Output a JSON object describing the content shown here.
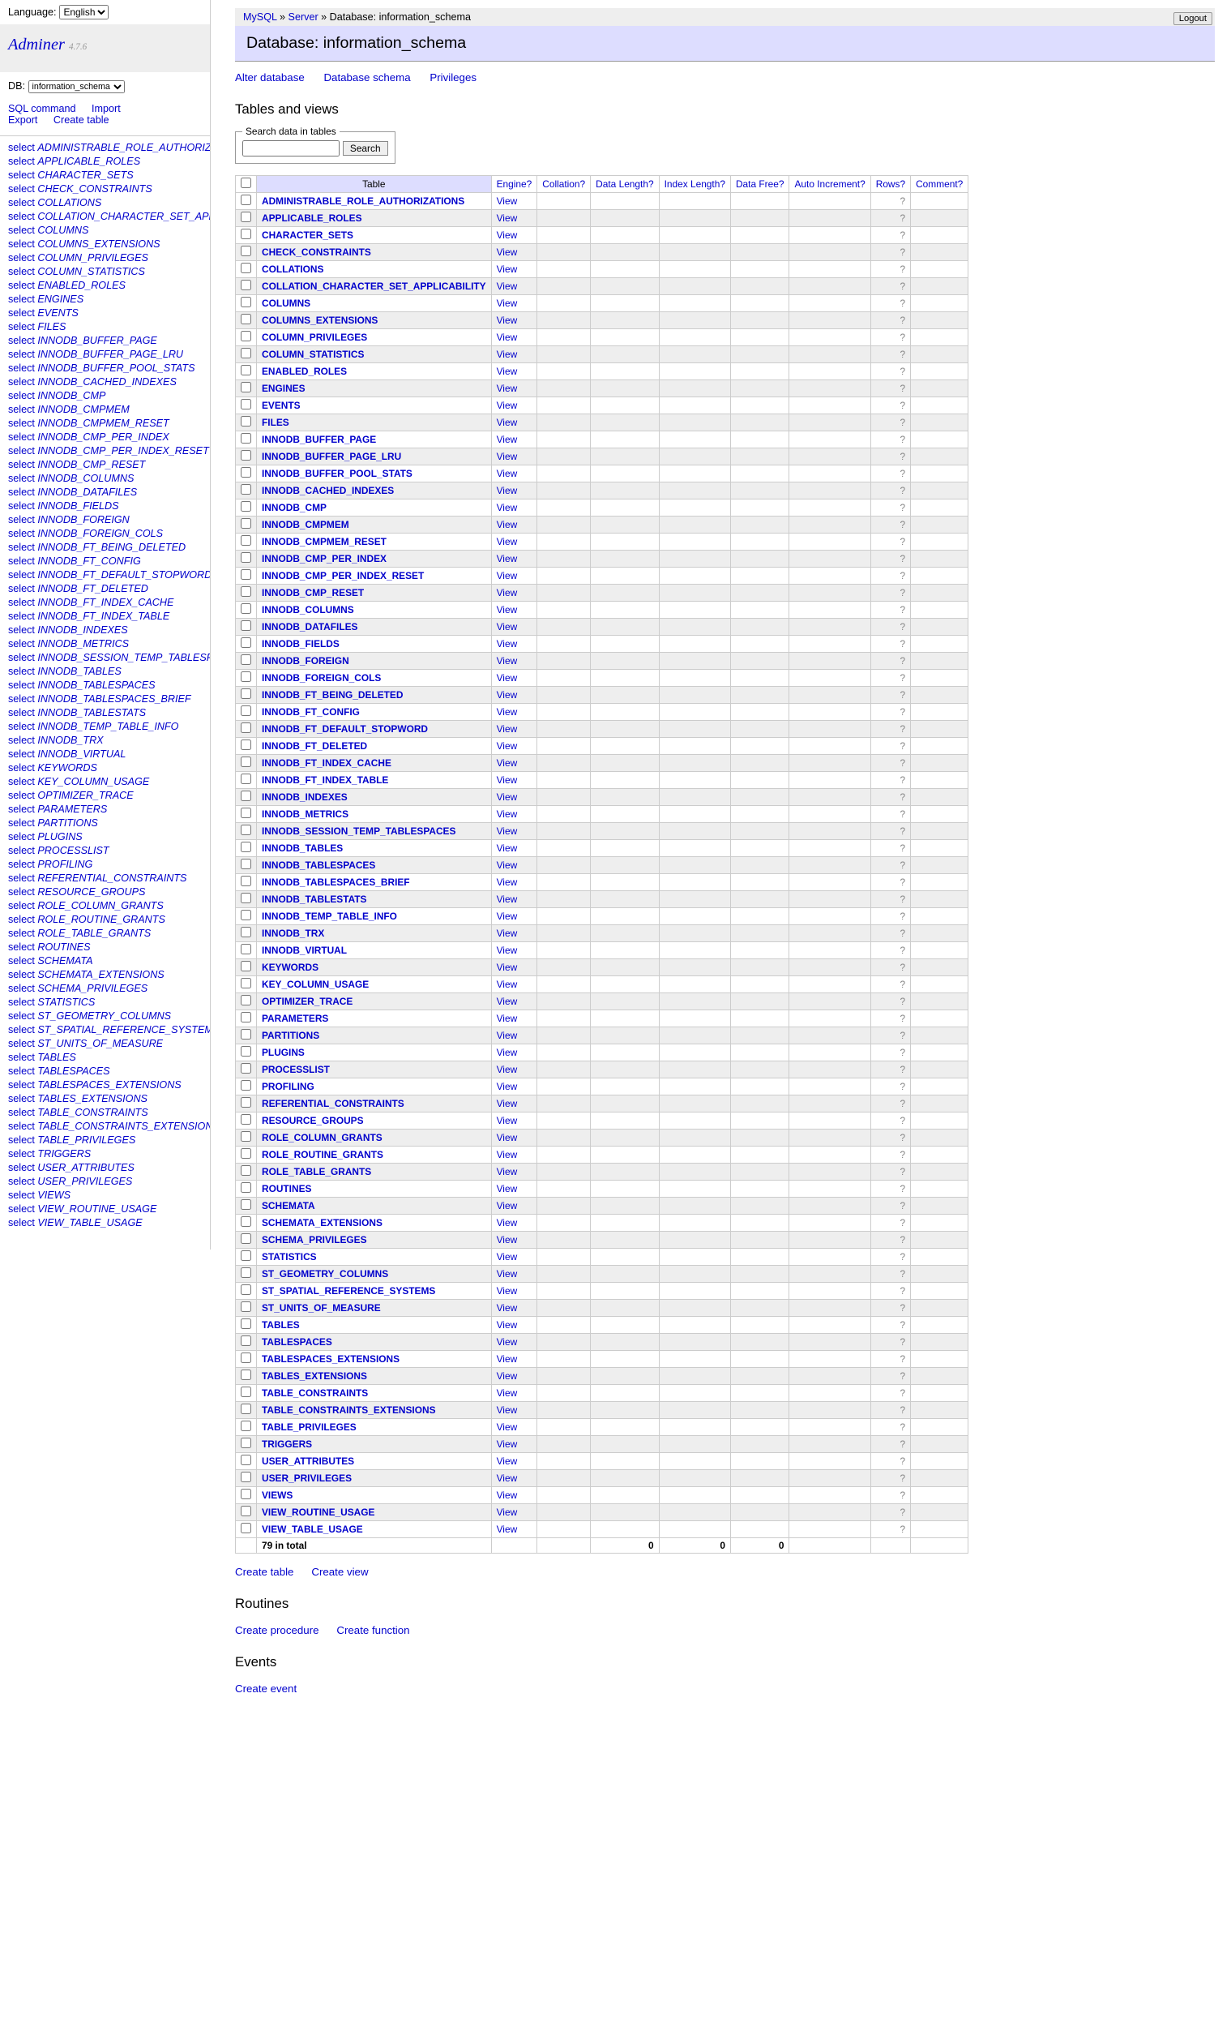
{
  "lang": {
    "label": "Language:",
    "value": "English"
  },
  "brand": {
    "name": "Adminer",
    "version": "4.7.6"
  },
  "db": {
    "label": "DB:",
    "value": "information_schema"
  },
  "menu_actions": {
    "sql": "SQL command",
    "import": "Import",
    "export": "Export",
    "create": "Create table"
  },
  "sidebar_prefix": "select",
  "breadcrumbs": {
    "driver": "MySQL",
    "server": "Server",
    "db_label": "Database:",
    "db": "information_schema"
  },
  "logout": "Logout",
  "heading": "Database: information_schema",
  "db_links": {
    "alter": "Alter database",
    "schema": "Database schema",
    "priv": "Privileges"
  },
  "section_tables": "Tables and views",
  "search": {
    "legend": "Search data in tables",
    "button": "Search"
  },
  "columns": {
    "table": "Table",
    "engine": "Engine",
    "collation": "Collation",
    "data_len": "Data Length",
    "index_len": "Index Length",
    "data_free": "Data Free",
    "auto_inc": "Auto Increment",
    "rows": "Rows",
    "comment": "Comment"
  },
  "doc_mark": "?",
  "row_view": "View",
  "row_q": "?",
  "tables": [
    "ADMINISTRABLE_ROLE_AUTHORIZATIONS",
    "APPLICABLE_ROLES",
    "CHARACTER_SETS",
    "CHECK_CONSTRAINTS",
    "COLLATIONS",
    "COLLATION_CHARACTER_SET_APPLICABILITY",
    "COLUMNS",
    "COLUMNS_EXTENSIONS",
    "COLUMN_PRIVILEGES",
    "COLUMN_STATISTICS",
    "ENABLED_ROLES",
    "ENGINES",
    "EVENTS",
    "FILES",
    "INNODB_BUFFER_PAGE",
    "INNODB_BUFFER_PAGE_LRU",
    "INNODB_BUFFER_POOL_STATS",
    "INNODB_CACHED_INDEXES",
    "INNODB_CMP",
    "INNODB_CMPMEM",
    "INNODB_CMPMEM_RESET",
    "INNODB_CMP_PER_INDEX",
    "INNODB_CMP_PER_INDEX_RESET",
    "INNODB_CMP_RESET",
    "INNODB_COLUMNS",
    "INNODB_DATAFILES",
    "INNODB_FIELDS",
    "INNODB_FOREIGN",
    "INNODB_FOREIGN_COLS",
    "INNODB_FT_BEING_DELETED",
    "INNODB_FT_CONFIG",
    "INNODB_FT_DEFAULT_STOPWORD",
    "INNODB_FT_DELETED",
    "INNODB_FT_INDEX_CACHE",
    "INNODB_FT_INDEX_TABLE",
    "INNODB_INDEXES",
    "INNODB_METRICS",
    "INNODB_SESSION_TEMP_TABLESPACES",
    "INNODB_TABLES",
    "INNODB_TABLESPACES",
    "INNODB_TABLESPACES_BRIEF",
    "INNODB_TABLESTATS",
    "INNODB_TEMP_TABLE_INFO",
    "INNODB_TRX",
    "INNODB_VIRTUAL",
    "KEYWORDS",
    "KEY_COLUMN_USAGE",
    "OPTIMIZER_TRACE",
    "PARAMETERS",
    "PARTITIONS",
    "PLUGINS",
    "PROCESSLIST",
    "PROFILING",
    "REFERENTIAL_CONSTRAINTS",
    "RESOURCE_GROUPS",
    "ROLE_COLUMN_GRANTS",
    "ROLE_ROUTINE_GRANTS",
    "ROLE_TABLE_GRANTS",
    "ROUTINES",
    "SCHEMATA",
    "SCHEMATA_EXTENSIONS",
    "SCHEMA_PRIVILEGES",
    "STATISTICS",
    "ST_GEOMETRY_COLUMNS",
    "ST_SPATIAL_REFERENCE_SYSTEMS",
    "ST_UNITS_OF_MEASURE",
    "TABLES",
    "TABLESPACES",
    "TABLESPACES_EXTENSIONS",
    "TABLES_EXTENSIONS",
    "TABLE_CONSTRAINTS",
    "TABLE_CONSTRAINTS_EXTENSIONS",
    "TABLE_PRIVILEGES",
    "TRIGGERS",
    "USER_ATTRIBUTES",
    "USER_PRIVILEGES",
    "VIEWS",
    "VIEW_ROUTINE_USAGE",
    "VIEW_TABLE_USAGE"
  ],
  "totals": {
    "label": "79 in total",
    "data_len": "0",
    "index_len": "0",
    "data_free": "0"
  },
  "footer": {
    "create_table": "Create table",
    "create_view": "Create view",
    "routines": "Routines",
    "create_proc": "Create procedure",
    "create_func": "Create function",
    "events": "Events",
    "create_event": "Create event"
  }
}
